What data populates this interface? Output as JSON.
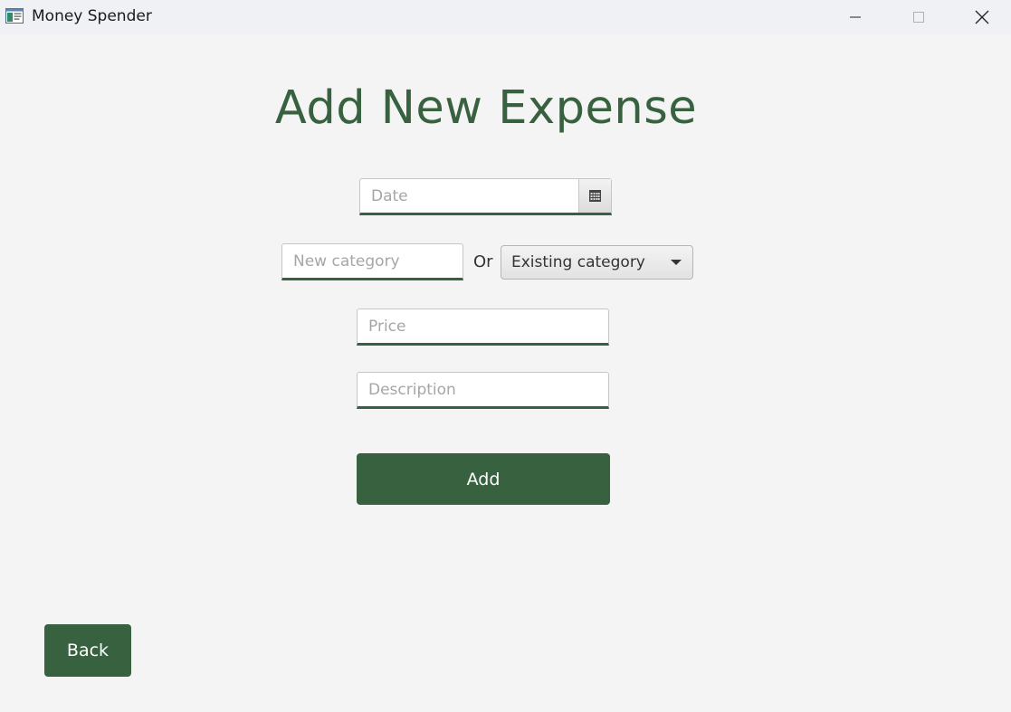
{
  "window": {
    "title": "Money Spender",
    "icons": {
      "app": "app-window-icon",
      "minimize": "minimize-icon",
      "maximize": "maximize-icon",
      "close": "close-icon"
    }
  },
  "form": {
    "heading": "Add New Expense",
    "date": {
      "placeholder": "Date",
      "value": "",
      "button_icon": "calendar-icon"
    },
    "new_category": {
      "placeholder": "New category",
      "value": ""
    },
    "or_label": "Or",
    "existing_category": {
      "selected": "Existing category",
      "icon": "chevron-down-icon"
    },
    "price": {
      "placeholder": "Price",
      "value": ""
    },
    "description": {
      "placeholder": "Description",
      "value": ""
    },
    "add_label": "Add"
  },
  "footer": {
    "back_label": "Back"
  },
  "colors": {
    "accent": "#386140",
    "background": "#f4f4f4",
    "titlebar": "#f0f1f5"
  }
}
